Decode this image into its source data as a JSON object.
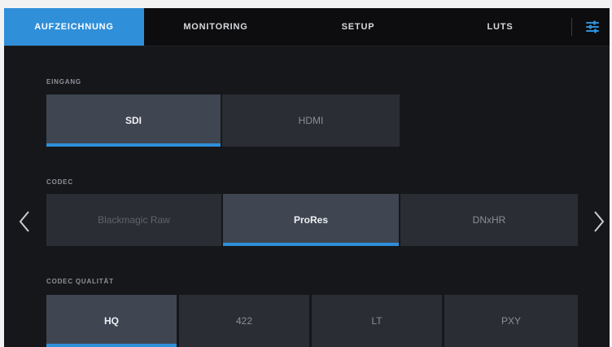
{
  "tabs": [
    {
      "label": "AUFZEICHNUNG",
      "active": true
    },
    {
      "label": "MONITORING",
      "active": false
    },
    {
      "label": "SETUP",
      "active": false
    },
    {
      "label": "LUTS",
      "active": false
    }
  ],
  "settings_icon": "sliders-icon",
  "sections": {
    "source": {
      "label": "EINGANG",
      "options": [
        "SDI",
        "HDMI"
      ],
      "selected": "SDI"
    },
    "codec": {
      "label": "CODEC",
      "options": [
        "Blackmagic Raw",
        "ProRes",
        "DNxHR"
      ],
      "selected": "ProRes"
    },
    "quality": {
      "label": "CODEC QUALITÄT",
      "options": [
        "HQ",
        "422",
        "LT",
        "PXY"
      ],
      "selected": "HQ"
    }
  },
  "nav": {
    "prev_icon": "chevron-left-icon",
    "next_icon": "chevron-right-icon"
  },
  "colors": {
    "accent": "#2f8fd9",
    "background": "#16171a",
    "tabbar": "#0d0d0f"
  }
}
